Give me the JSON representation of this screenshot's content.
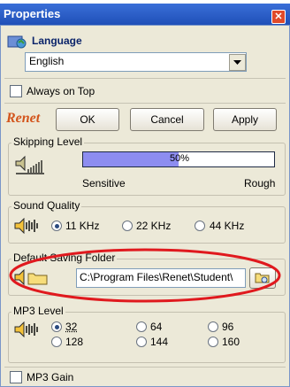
{
  "window": {
    "title": "Properties"
  },
  "language": {
    "header": "Language",
    "selected": "English"
  },
  "always_on_top": {
    "label": "Always on Top",
    "checked": false
  },
  "buttons": {
    "ok": "OK",
    "cancel": "Cancel",
    "apply": "Apply",
    "logo_text": "Renet"
  },
  "skipping": {
    "title": "Skipping Level",
    "percent": "50%",
    "level_fraction": 0.5,
    "left": "Sensitive",
    "right": "Rough"
  },
  "sound_quality": {
    "title": "Sound Quality",
    "options": [
      "11 KHz",
      "22 KHz",
      "44 KHz"
    ],
    "selected": "11 KHz"
  },
  "saving_folder": {
    "title": "Default Saving Folder",
    "path": "C:\\Program Files\\Renet\\Student\\"
  },
  "mp3_level": {
    "title": "MP3 Level",
    "options": [
      "32",
      "64",
      "96",
      "128",
      "144",
      "160"
    ],
    "selected": "32"
  },
  "mp3_gain": {
    "label": "MP3 Gain",
    "checked": false
  },
  "colors": {
    "accent": "#1f4fb8",
    "highlight_circle": "#e0191e",
    "progress": "#8d8df0"
  }
}
